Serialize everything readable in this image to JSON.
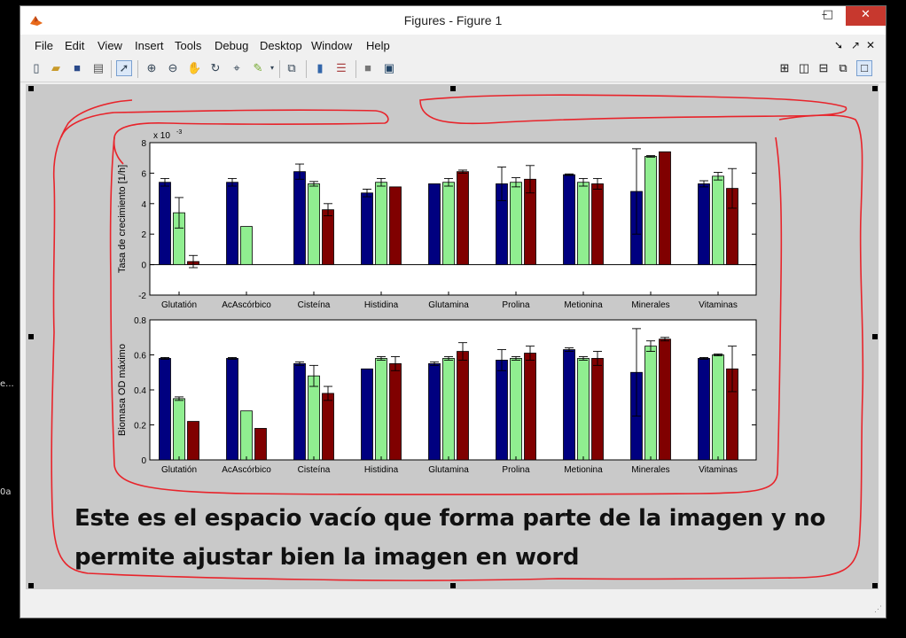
{
  "background": {
    "left_texts": [
      "e...",
      "0a"
    ]
  },
  "window": {
    "title": "Figures - Figure 1",
    "min": "–",
    "max": "□",
    "close": "✕"
  },
  "menu": {
    "items": [
      "File",
      "Edit",
      "View",
      "Insert",
      "Tools",
      "Debug",
      "Desktop",
      "Window",
      "Help"
    ],
    "right": [
      "➘",
      "↗",
      "✕"
    ]
  },
  "toolbar": {
    "icons": [
      "new-file-icon",
      "open-folder-icon",
      "save-icon",
      "print-icon",
      "pointer-icon",
      "zoom-in-icon",
      "zoom-out-icon",
      "pan-icon",
      "rotate-icon",
      "data-cursor-icon",
      "brush-icon",
      "link-icon",
      "colorbar-icon",
      "legend-icon",
      "hide-plot-tools-icon",
      "show-plot-tools-icon",
      "tile-icon",
      "left-right-icon",
      "top-bottom-icon",
      "float-icon",
      "maximize-icon"
    ]
  },
  "annotation": {
    "line1": "Este es el espacio vacío que forma parte de la imagen y no",
    "line2": "permite ajustar bien la imagen en word",
    "outline_color": "#e8242b"
  },
  "colors": {
    "series": [
      "#000080",
      "#90ee90",
      "#800000"
    ]
  },
  "chart_data": [
    {
      "type": "bar",
      "categories": [
        "Glutatión",
        "AcAscórbico",
        "Cisteína",
        "Histidina",
        "Glutamina",
        "Prolina",
        "Metionina",
        "Minerales",
        "Vitaminas"
      ],
      "ylabel": "Tasa de crecimiento [1/h]",
      "exponent_label": "x 10",
      "exponent_power": "-3",
      "ylim": [
        -2,
        8
      ],
      "yticks": [
        -2,
        0,
        2,
        4,
        6,
        8
      ],
      "series": [
        {
          "values": [
            5.4,
            5.4,
            6.1,
            4.7,
            5.3,
            5.3,
            5.9,
            4.8,
            5.3
          ],
          "errors": [
            0.25,
            0.25,
            0.5,
            0.25,
            0.0,
            1.1,
            0.05,
            2.8,
            0.2
          ]
        },
        {
          "values": [
            3.4,
            2.5,
            5.3,
            5.4,
            5.4,
            5.4,
            5.4,
            7.1,
            5.8
          ],
          "errors": [
            1.0,
            0.0,
            0.15,
            0.25,
            0.25,
            0.3,
            0.25,
            0.05,
            0.25
          ]
        },
        {
          "values": [
            0.2,
            null,
            3.6,
            5.1,
            6.1,
            5.6,
            5.3,
            7.4,
            5.0
          ],
          "errors": [
            0.4,
            null,
            0.4,
            0.0,
            0.1,
            0.9,
            0.35,
            0.0,
            1.3
          ]
        }
      ]
    },
    {
      "type": "bar",
      "categories": [
        "Glutatión",
        "AcAscórbico",
        "Cisteína",
        "Histidina",
        "Glutamina",
        "Prolina",
        "Metionina",
        "Minerales",
        "Vitaminas"
      ],
      "ylabel": "Biomasa OD máximo",
      "ylim": [
        0,
        0.8
      ],
      "yticks": [
        0,
        0.2,
        0.4,
        0.6,
        0.8
      ],
      "series": [
        {
          "values": [
            0.58,
            0.58,
            0.55,
            0.52,
            0.55,
            0.57,
            0.63,
            0.5,
            0.58
          ],
          "errors": [
            0.005,
            0.005,
            0.01,
            0.0,
            0.01,
            0.06,
            0.01,
            0.25,
            0.005
          ]
        },
        {
          "values": [
            0.35,
            0.28,
            0.48,
            0.58,
            0.58,
            0.58,
            0.58,
            0.65,
            0.6
          ],
          "errors": [
            0.01,
            0.0,
            0.06,
            0.01,
            0.01,
            0.01,
            0.01,
            0.03,
            0.005
          ]
        },
        {
          "values": [
            0.22,
            0.18,
            0.38,
            0.55,
            0.62,
            0.61,
            0.58,
            0.69,
            0.52
          ],
          "errors": [
            0.0,
            0.0,
            0.04,
            0.04,
            0.05,
            0.04,
            0.04,
            0.01,
            0.13
          ]
        }
      ]
    }
  ]
}
